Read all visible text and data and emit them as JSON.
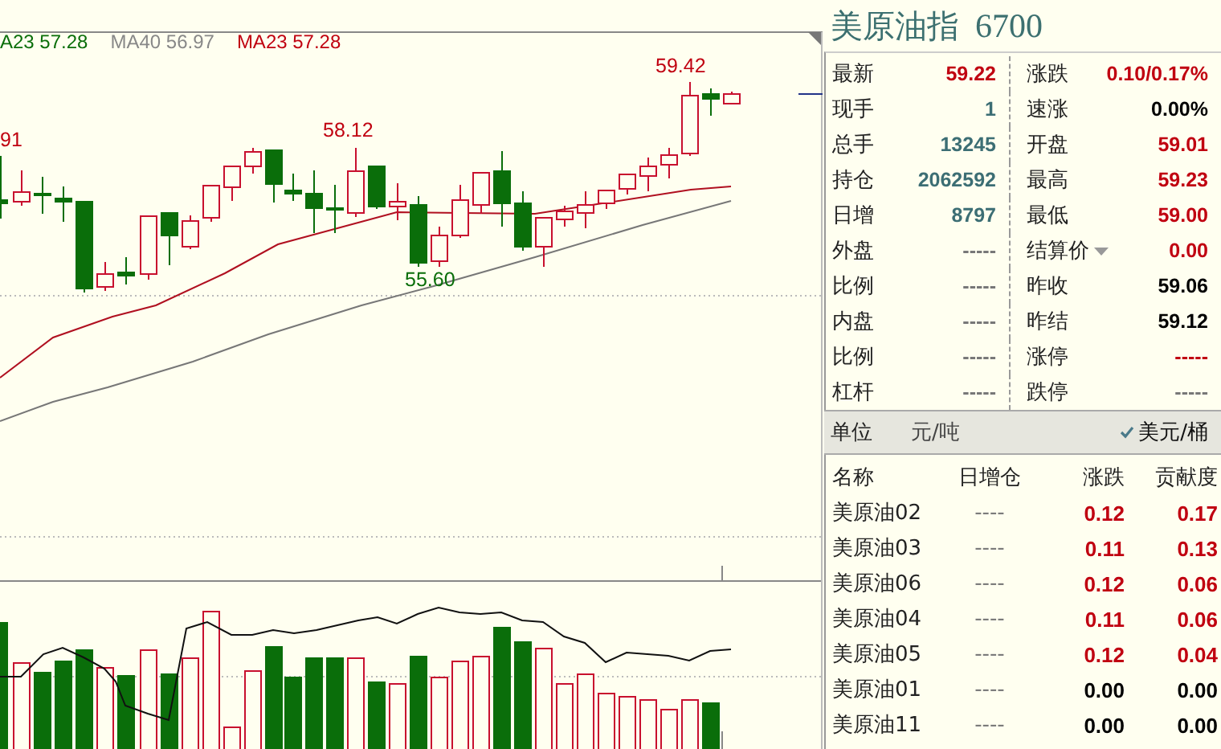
{
  "chart": {
    "ma_legend": [
      {
        "text": "A23 57.28",
        "color": "#0a6e0a"
      },
      {
        "text": "MA40 56.97",
        "color": "#888888"
      },
      {
        "text": "MA23 57.28",
        "color": "#c00010"
      }
    ],
    "price_labels": [
      {
        "text": "91",
        "color": "#c00010"
      },
      {
        "text": "58.12",
        "color": "#c00010"
      },
      {
        "text": "55.60",
        "color": "#0a6e0a"
      },
      {
        "text": "59.42",
        "color": "#c00010"
      }
    ]
  },
  "quote": {
    "title": "美原油指",
    "code": "6700",
    "rows": [
      {
        "left": {
          "label": "最新",
          "value": "59.22",
          "color": "#c00010"
        },
        "right": {
          "label": "涨跌",
          "value": "0.10/0.17%",
          "color": "#c00010"
        }
      },
      {
        "left": {
          "label": "现手",
          "value": "1",
          "color": "#3c6e74"
        },
        "right": {
          "label": "速涨",
          "value": "0.00%",
          "color": "#000000"
        }
      },
      {
        "left": {
          "label": "总手",
          "value": "13245",
          "color": "#3c6e74"
        },
        "right": {
          "label": "开盘",
          "value": "59.01",
          "color": "#c00010"
        }
      },
      {
        "left": {
          "label": "持仓",
          "value": "2062592",
          "color": "#3c6e74"
        },
        "right": {
          "label": "最高",
          "value": "59.23",
          "color": "#c00010"
        }
      },
      {
        "left": {
          "label": "日增",
          "value": "8797",
          "color": "#3c6e74"
        },
        "right": {
          "label": "最低",
          "value": "59.00",
          "color": "#c00010"
        }
      },
      {
        "left": {
          "label": "外盘",
          "value": "-----",
          "color": "#777777"
        },
        "right": {
          "label": "结算价",
          "value": "0.00",
          "color": "#c00010",
          "dropdown": true
        }
      },
      {
        "left": {
          "label": "比例",
          "value": "-----",
          "color": "#777777"
        },
        "right": {
          "label": "昨收",
          "value": "59.06",
          "color": "#000000"
        }
      },
      {
        "left": {
          "label": "内盘",
          "value": "-----",
          "color": "#777777"
        },
        "right": {
          "label": "昨结",
          "value": "59.12",
          "color": "#000000"
        }
      },
      {
        "left": {
          "label": "比例",
          "value": "-----",
          "color": "#777777"
        },
        "right": {
          "label": "涨停",
          "value": "-----",
          "color": "#c00010"
        }
      },
      {
        "left": {
          "label": "杠杆",
          "value": "-----",
          "color": "#777777"
        },
        "right": {
          "label": "跌停",
          "value": "-----",
          "color": "#777777"
        }
      }
    ]
  },
  "unit": {
    "label": "单位",
    "options": [
      {
        "label": "元/吨",
        "selected": false
      },
      {
        "label": "美元/桶",
        "selected": true
      }
    ]
  },
  "table": {
    "columns": [
      "名称",
      "日增仓",
      "涨跌",
      "贡献度"
    ],
    "rows": [
      {
        "name": "美原油02",
        "oi": "----",
        "change": "0.12",
        "contrib": "0.17",
        "color": "#c00010"
      },
      {
        "name": "美原油03",
        "oi": "----",
        "change": "0.11",
        "contrib": "0.13",
        "color": "#c00010"
      },
      {
        "name": "美原油06",
        "oi": "----",
        "change": "0.12",
        "contrib": "0.06",
        "color": "#c00010"
      },
      {
        "name": "美原油04",
        "oi": "----",
        "change": "0.11",
        "contrib": "0.06",
        "color": "#c00010"
      },
      {
        "name": "美原油05",
        "oi": "----",
        "change": "0.12",
        "contrib": "0.04",
        "color": "#c00010"
      },
      {
        "name": "美原油01",
        "oi": "----",
        "change": "0.00",
        "contrib": "0.00",
        "color": "#000000"
      },
      {
        "name": "美原油11",
        "oi": "----",
        "change": "0.00",
        "contrib": "0.00",
        "color": "#000000"
      }
    ]
  }
}
